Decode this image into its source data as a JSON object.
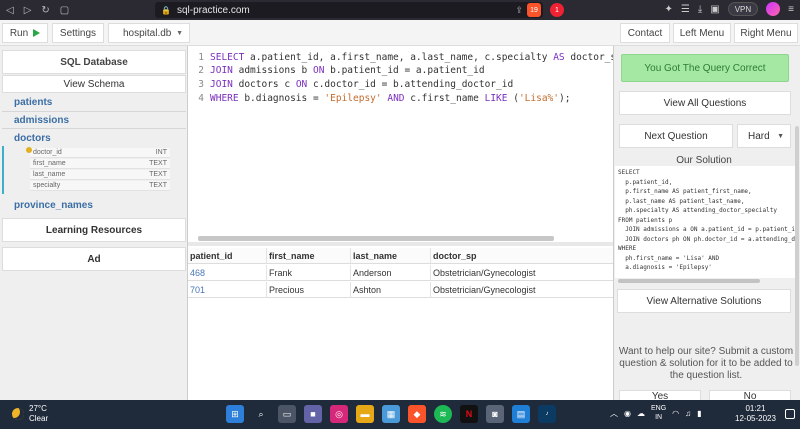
{
  "browser": {
    "url": "sql-practice.com",
    "brave_badge": "19",
    "alert_badge": "1",
    "vpn_label": "VPN"
  },
  "toolbar": {
    "run_label": "Run",
    "settings_label": "Settings",
    "database": "hospital.db",
    "contact_label": "Contact",
    "left_menu_label": "Left Menu",
    "right_menu_label": "Right Menu"
  },
  "sidebar": {
    "title": "SQL Database",
    "view_schema": "View Schema",
    "tables": [
      "patients",
      "admissions",
      "doctors",
      "province_names"
    ],
    "doctor_columns": [
      {
        "name": "doctor_id",
        "type": "INT"
      },
      {
        "name": "first_name",
        "type": "TEXT"
      },
      {
        "name": "last_name",
        "type": "TEXT"
      },
      {
        "name": "specialty",
        "type": "TEXT"
      }
    ],
    "learning_resources": "Learning Resources",
    "ad": "Ad"
  },
  "editor": {
    "lines": [
      {
        "num": "1"
      },
      {
        "num": "2"
      },
      {
        "num": "3"
      },
      {
        "num": "4"
      }
    ]
  },
  "results": {
    "headers": [
      "patient_id",
      "first_name",
      "last_name",
      "doctor_sp"
    ],
    "rows": [
      [
        "468",
        "Frank",
        "Anderson",
        "Obstetrician/Gynecologist"
      ],
      [
        "701",
        "Precious",
        "Ashton",
        "Obstetrician/Gynecologist"
      ]
    ]
  },
  "right_panel": {
    "correct_message": "You Got The Query Correct",
    "view_all": "View All Questions",
    "next_question": "Next Question",
    "difficulty": "Hard",
    "solution_title": "Our Solution",
    "solution_lines": [
      "SELECT",
      "  p.patient_id,",
      "  p.first_name AS patient_first_name,",
      "  p.last_name AS patient_last_name,",
      "  ph.specialty AS attending_doctor_specialty",
      "FROM patients p",
      "  JOIN admissions a ON a.patient_id = p.patient_id",
      "  JOIN doctors ph ON ph.doctor_id = a.attending_doctor_id",
      "WHERE",
      "  ph.first_name = 'Lisa' AND",
      "  a.diagnosis = 'Epilepsy'"
    ],
    "view_alternative": "View Alternative Solutions",
    "help_text": "Want to help our site? Submit a custom question & solution for it to be added to the question list.",
    "yes_label": "Yes",
    "no_label": "No"
  },
  "taskbar": {
    "temperature": "27°C",
    "weather": "Clear",
    "lang_top": "ENG",
    "lang_bottom": "IN",
    "time": "01:21",
    "date": "12-05-2023"
  }
}
